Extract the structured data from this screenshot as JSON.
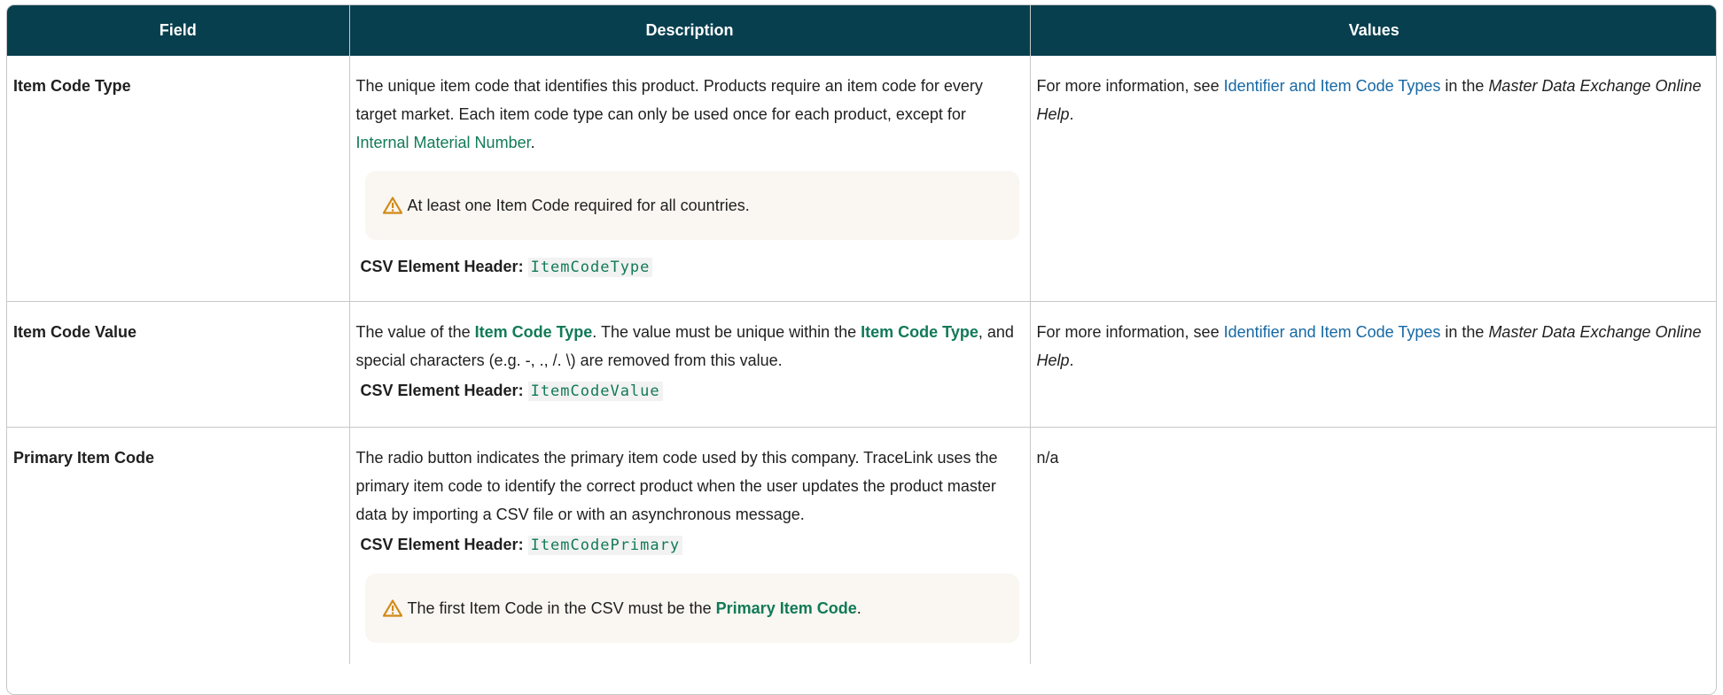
{
  "headers": {
    "field": "Field",
    "description": "Description",
    "values": "Values"
  },
  "rows": [
    {
      "field": "Item Code Type",
      "desc_text_1": "The unique item code that identifies this product. Products require an item code for every target market. Each item code type can only be used once for each product, except for ",
      "desc_link_1": "Internal Material Number",
      "desc_text_2": ".",
      "note_text": "At least one Item Code required for all countries.",
      "csv_label": "CSV Element Header:",
      "csv_code": "ItemCodeType",
      "values_text_1": "For more information, see ",
      "values_link": "Identifier and Item Code Types",
      "values_text_2": " in the ",
      "values_italic": "Master Data Exchange Online Help",
      "values_text_3": "."
    },
    {
      "field": "Item Code Value",
      "desc_text_1": "The value of the ",
      "desc_strong_1": "Item Code Type",
      "desc_text_2": ". The value must be unique within the ",
      "desc_strong_2": "Item Code Type",
      "desc_text_3": ", and special characters (e.g. -, ., /. \\) are removed from this value.",
      "csv_label": "CSV Element Header:",
      "csv_code": "ItemCodeValue",
      "values_text_1": "For more information, see ",
      "values_link": "Identifier and Item Code Types",
      "values_text_2": " in the ",
      "values_italic": "Master Data Exchange Online Help",
      "values_text_3": "."
    },
    {
      "field": "Primary Item Code",
      "desc_text_1": " The radio button indicates the primary item code used by this company. TraceLink uses the primary item code to identify the correct product when the user updates the product master data by importing a CSV file or with an asynchronous message.",
      "csv_label": "CSV Element Header:",
      "csv_code": "ItemCodePrimary",
      "note_text_1": "The first Item Code in the CSV must be the ",
      "note_strong": "Primary Item Code",
      "note_text_2": ".",
      "values_text": "n/a"
    }
  ],
  "icons": {
    "warning": "warning-triangle-icon"
  },
  "colors": {
    "header_bg": "#073f4e",
    "link_blue": "#1668a4",
    "link_green": "#117a58",
    "note_bg": "#faf6f1",
    "warning": "#d08a16"
  }
}
